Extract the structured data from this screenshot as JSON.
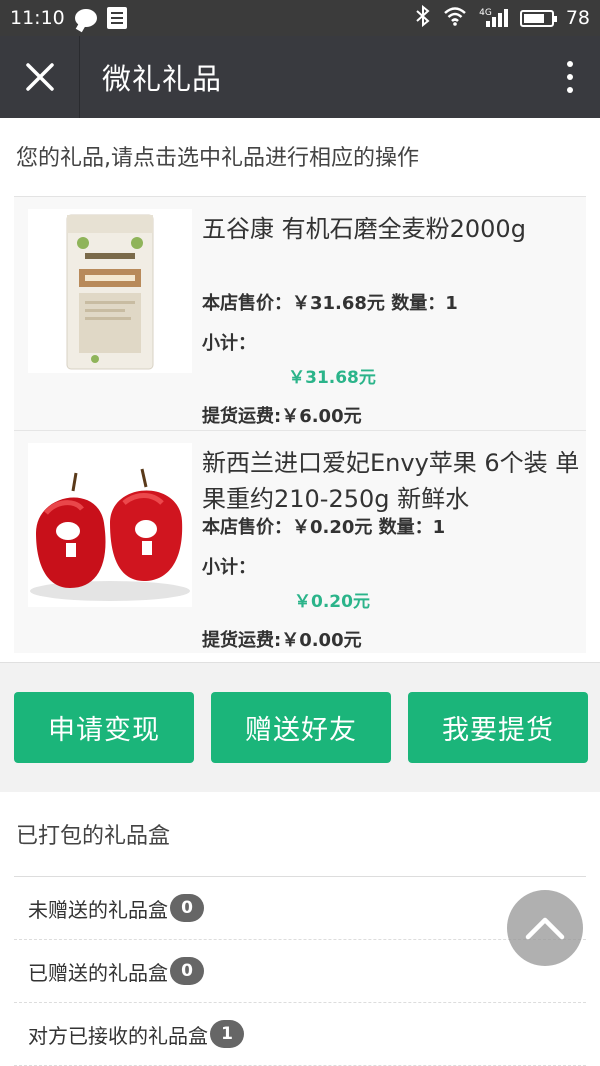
{
  "status_bar": {
    "time": "11:10",
    "network": "4G",
    "battery": "78"
  },
  "navbar": {
    "title": "微礼礼品"
  },
  "tip": "您的礼品,请点击选中礼品进行相应的操作",
  "gifts": [
    {
      "name": "五谷康 有机石磨全麦粉2000g",
      "price_line": "本店售价：￥31.68元 数量：1",
      "subtotal_label": "小计：",
      "subtotal_value": "￥31.68元",
      "shipping_line": "提货运费:￥6.00元",
      "image_icon": "flour-bag-image"
    },
    {
      "name": "新西兰进口爱妃Envy苹果 6个装 单果重约210-250g 新鲜水",
      "price_line": "本店售价：￥0.20元 数量：1",
      "subtotal_label": "小计：",
      "subtotal_value": "￥0.20元",
      "shipping_line": "提货运费:￥0.00元",
      "image_icon": "apples-image"
    }
  ],
  "actions": {
    "cash_out": "申请变现",
    "gift_friend": "赠送好友",
    "pickup": "我要提货"
  },
  "packed": {
    "title": "已打包的礼品盒",
    "items": [
      {
        "label": "未赠送的礼品盒",
        "count": "0"
      },
      {
        "label": "已赠送的礼品盒",
        "count": "0"
      },
      {
        "label": "对方已接收的礼品盒",
        "count": "1"
      }
    ]
  },
  "colors": {
    "accent": "#1bb57a",
    "price_green": "#2bb48a",
    "navbar": "#393a3f"
  }
}
